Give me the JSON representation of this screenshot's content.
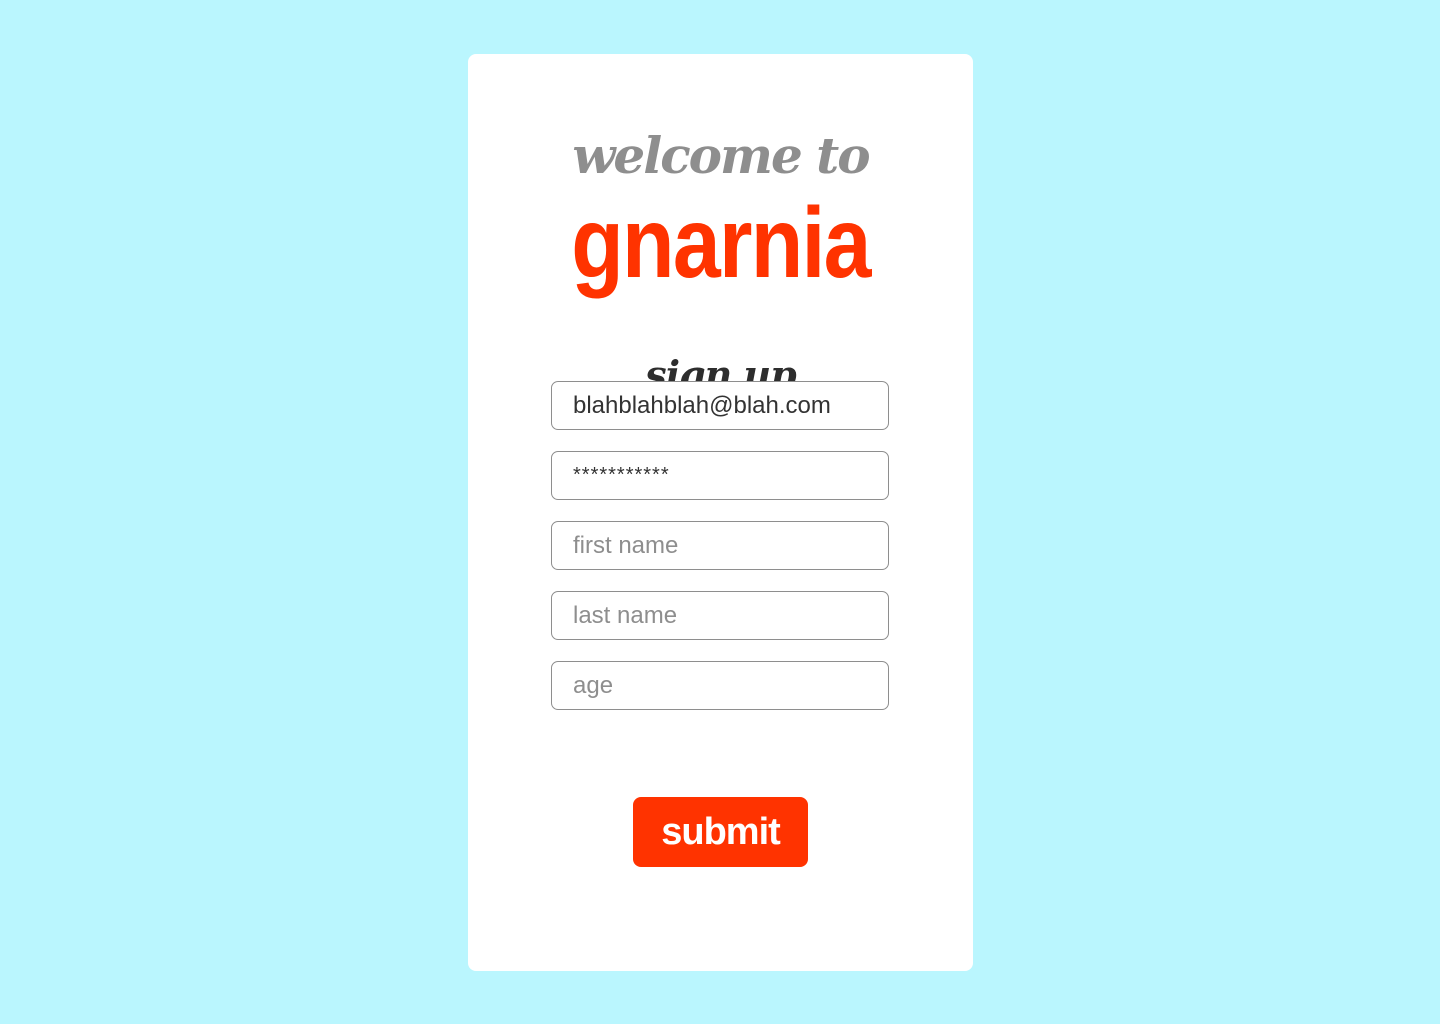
{
  "header": {
    "welcome_text": "welcome to",
    "brand_name": "gnarnia"
  },
  "form": {
    "heading": "sign up",
    "fields": {
      "email": {
        "value": "blahblahblah@blah.com",
        "placeholder": ""
      },
      "password": {
        "value": "***********",
        "placeholder": ""
      },
      "first_name": {
        "value": "",
        "placeholder": "first name"
      },
      "last_name": {
        "value": "",
        "placeholder": "last name"
      },
      "age": {
        "value": "",
        "placeholder": "age"
      }
    },
    "submit_label": "submit"
  },
  "colors": {
    "background": "#baf6fe",
    "card": "#ffffff",
    "accent": "#ff3300",
    "muted_text": "#8e8e8e",
    "heading_text": "#2d2d2d"
  }
}
